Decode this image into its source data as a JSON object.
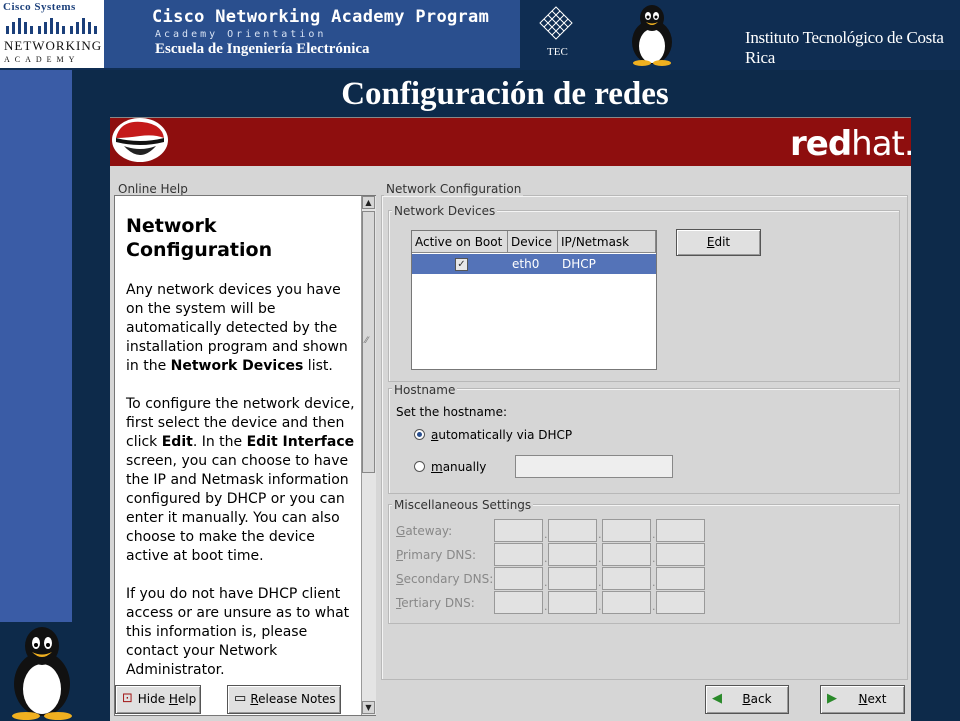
{
  "header": {
    "cisco_systems": "Cisco Systems",
    "cisco_networking": "NETWORKING",
    "cisco_academy": "ACADEMY",
    "program_title": "Cisco Networking Academy Program",
    "program_subtitle": "Academy Orientation",
    "school": "Escuela de Ingeniería Electrónica",
    "tec_logo_text": "TEC",
    "institution": "Instituto Tecnológico de Costa Rica"
  },
  "slide_title": "Configuración de redes",
  "brand": {
    "red": "red",
    "hat": "hat."
  },
  "help": {
    "label": "Online Help",
    "heading": "Network Configuration",
    "p1_a": "Any network devices you have on the system will be automatically detected by the installation program and shown in the ",
    "p1_b": "Network Devices",
    "p1_c": " list.",
    "p2_a": "To configure the network device, first select the device and then click ",
    "p2_b": "Edit",
    "p2_c": ". In the ",
    "p2_d": "Edit Interface",
    "p2_e": " screen, you can choose to have the IP and Netmask information configured by DHCP or you can enter it manually. You can also choose to make the device active at boot time.",
    "p3": "If you do not have DHCP client access or are unsure as to what this information is, please contact your Network Administrator."
  },
  "network": {
    "label": "Network Configuration",
    "devices_label": "Network Devices",
    "columns": [
      "Active on Boot",
      "Device",
      "IP/Netmask"
    ],
    "rows": [
      {
        "active": true,
        "device": "eth0",
        "ip": "DHCP"
      }
    ],
    "edit_first": "E",
    "edit_rest": "dit",
    "hostname_label": "Hostname",
    "set_hostname": "Set the hostname:",
    "auto_first": "a",
    "auto_rest": "utomatically via DHCP",
    "man_first": "m",
    "man_rest": "anually",
    "misc_label": "Miscellaneous Settings",
    "gateway_first": "G",
    "gateway_rest": "ateway:",
    "pdns_first": "P",
    "pdns_rest": "rimary DNS:",
    "sdns_first": "S",
    "sdns_rest": "econdary DNS:",
    "tdns_first": "T",
    "tdns_rest": "ertiary DNS:",
    "dot": "."
  },
  "buttons": {
    "hide_help_a": "Hide ",
    "hide_help_b": "H",
    "hide_help_c": "elp",
    "release_a": "R",
    "release_b": "elease Notes",
    "back_a": "B",
    "back_b": "ack",
    "next_a": "N",
    "next_b": "ext"
  },
  "colors": {
    "selection": "#5473b8",
    "banner": "#8e0e0e",
    "slide_bg": "#0d2a4a",
    "cna_band": "#2a4f8e"
  }
}
